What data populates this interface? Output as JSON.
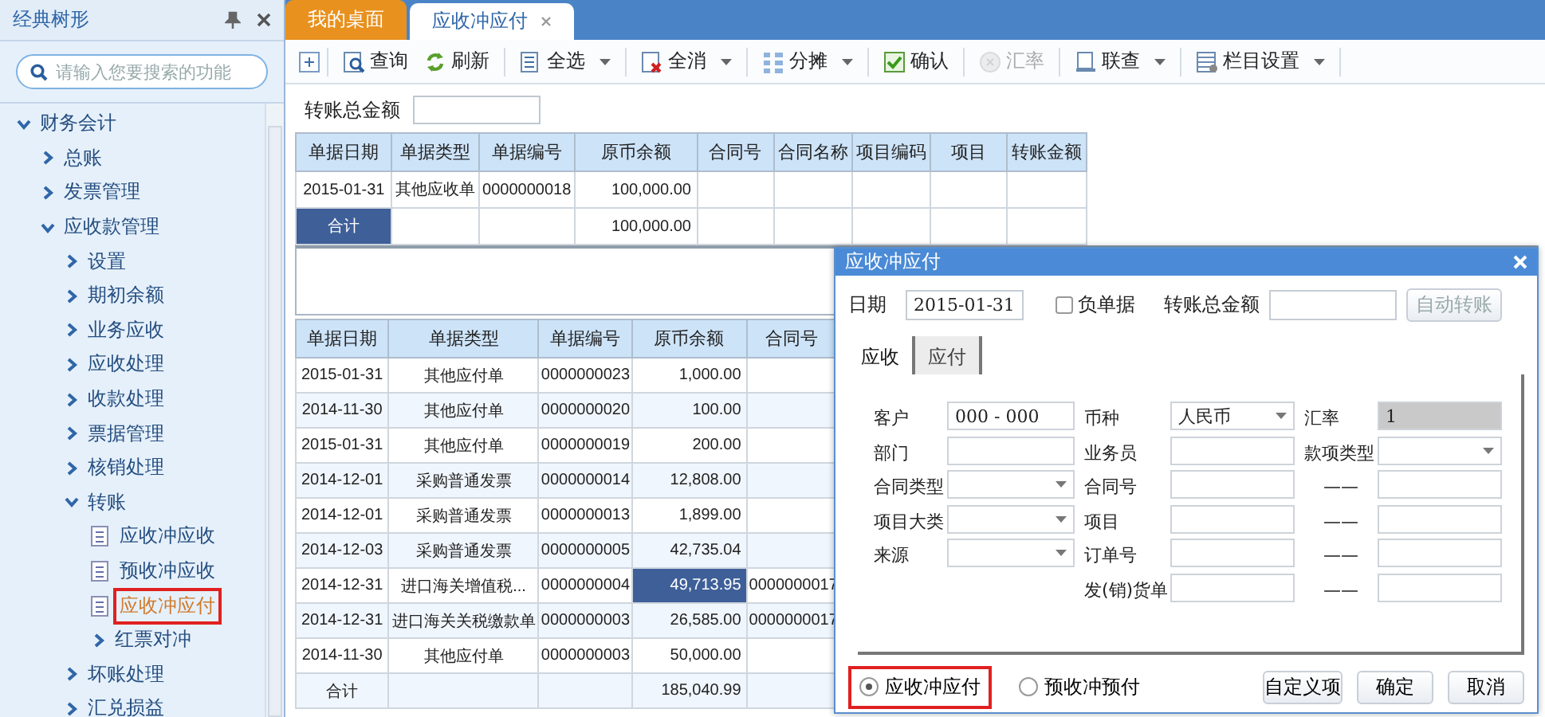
{
  "sidebar": {
    "title": "经典树形",
    "search": {
      "placeholder": "请输入您要搜索的功能"
    },
    "tree": [
      {
        "label": "财务会计",
        "kind": "folder",
        "expanded": true,
        "selected": false,
        "highlighted": false,
        "children": [
          {
            "label": "总账",
            "kind": "folder",
            "expanded": false,
            "selected": false,
            "highlighted": false
          },
          {
            "label": "发票管理",
            "kind": "folder",
            "expanded": false,
            "selected": false,
            "highlighted": false
          },
          {
            "label": "应收款管理",
            "kind": "folder",
            "expanded": true,
            "selected": false,
            "highlighted": false,
            "children": [
              {
                "label": "设置",
                "kind": "folder",
                "expanded": false,
                "selected": false,
                "highlighted": false
              },
              {
                "label": "期初余额",
                "kind": "folder",
                "expanded": false,
                "selected": false,
                "highlighted": false
              },
              {
                "label": "业务应收",
                "kind": "folder",
                "expanded": false,
                "selected": false,
                "highlighted": false
              },
              {
                "label": "应收处理",
                "kind": "folder",
                "expanded": false,
                "selected": false,
                "highlighted": false
              },
              {
                "label": "收款处理",
                "kind": "folder",
                "expanded": false,
                "selected": false,
                "highlighted": false
              },
              {
                "label": "票据管理",
                "kind": "folder",
                "expanded": false,
                "selected": false,
                "highlighted": false
              },
              {
                "label": "核销处理",
                "kind": "folder",
                "expanded": false,
                "selected": false,
                "highlighted": false
              },
              {
                "label": "转账",
                "kind": "folder",
                "expanded": true,
                "selected": false,
                "highlighted": false,
                "children": [
                  {
                    "label": "应收冲应收",
                    "kind": "page",
                    "selected": false,
                    "highlighted": false
                  },
                  {
                    "label": "预收冲应收",
                    "kind": "page",
                    "selected": false,
                    "highlighted": false
                  },
                  {
                    "label": "应收冲应付",
                    "kind": "page",
                    "selected": true,
                    "highlighted": true
                  },
                  {
                    "label": "红票对冲",
                    "kind": "folder",
                    "expanded": false,
                    "selected": false,
                    "highlighted": false
                  }
                ]
              },
              {
                "label": "坏账处理",
                "kind": "folder",
                "expanded": false,
                "selected": false,
                "highlighted": false
              },
              {
                "label": "汇兑损益",
                "kind": "folder",
                "expanded": false,
                "selected": false,
                "highlighted": false
              }
            ]
          }
        ]
      }
    ]
  },
  "tabs": [
    {
      "label": "我的桌面",
      "kind": "home",
      "selected": false,
      "closable": false
    },
    {
      "label": "应收冲应付",
      "kind": "page",
      "selected": true,
      "closable": true
    }
  ],
  "toolbar": [
    [
      {
        "kind": "add"
      }
    ],
    [
      {
        "kind": "query",
        "label": "查询",
        "dropdown": false,
        "disabled": false
      },
      {
        "kind": "refresh",
        "label": "刷新",
        "dropdown": false,
        "disabled": false
      }
    ],
    [
      {
        "kind": "select-all",
        "label": "全选",
        "dropdown": true,
        "disabled": false
      }
    ],
    [
      {
        "kind": "clear-all",
        "label": "全消",
        "dropdown": true,
        "disabled": false
      }
    ],
    [
      {
        "kind": "split",
        "label": "分摊",
        "dropdown": true,
        "disabled": false
      }
    ],
    [
      {
        "kind": "confirm",
        "label": "确认",
        "dropdown": false,
        "disabled": false
      }
    ],
    [
      {
        "kind": "rate",
        "label": "汇率",
        "dropdown": false,
        "disabled": true
      }
    ],
    [
      {
        "kind": "link",
        "label": "联查",
        "dropdown": true,
        "disabled": false
      }
    ],
    [
      {
        "kind": "columns",
        "label": "栏目设置",
        "dropdown": true,
        "disabled": false
      }
    ]
  ],
  "transfer_total": {
    "label": "转账总金额"
  },
  "receivable_grid": {
    "columns": [
      "单据日期",
      "单据类型",
      "单据编号",
      "原币余额",
      "合同号",
      "合同名称",
      "项目编码",
      "项目",
      "转账金额"
    ],
    "rows": [
      {
        "kind": "data",
        "cells": [
          {
            "text": "2015-01-31",
            "selected": false
          },
          {
            "text": "其他应收单",
            "selected": false
          },
          {
            "text": "0000000018",
            "selected": false
          },
          {
            "text": "100,000.00",
            "selected": false
          },
          {
            "selected": false
          },
          {
            "selected": false
          },
          {
            "selected": false
          },
          {
            "selected": false
          },
          {
            "selected": false
          }
        ]
      },
      {
        "kind": "total",
        "cells": [
          {
            "text": "合计",
            "selected": true
          },
          {
            "selected": false
          },
          {
            "selected": false
          },
          {
            "text": "100,000.00",
            "selected": false
          },
          {
            "selected": false
          },
          {
            "selected": false
          },
          {
            "selected": false
          },
          {
            "selected": false
          },
          {
            "selected": false
          }
        ]
      }
    ]
  },
  "payable_grid": {
    "columns": [
      "单据日期",
      "单据类型",
      "单据编号",
      "原币余额",
      "合同号"
    ],
    "rows": [
      {
        "kind": "data",
        "cells": [
          {
            "text": "2015-01-31",
            "selected": false
          },
          {
            "text": "其他应付单",
            "selected": false
          },
          {
            "text": "0000000023",
            "selected": false
          },
          {
            "text": "1,000.00",
            "selected": false
          },
          {
            "selected": false
          }
        ]
      },
      {
        "kind": "data",
        "cells": [
          {
            "text": "2014-11-30",
            "selected": false
          },
          {
            "text": "其他应付单",
            "selected": false
          },
          {
            "text": "0000000020",
            "selected": false
          },
          {
            "text": "100.00",
            "selected": false
          },
          {
            "selected": false
          }
        ]
      },
      {
        "kind": "data",
        "cells": [
          {
            "text": "2015-01-31",
            "selected": false
          },
          {
            "text": "其他应付单",
            "selected": false
          },
          {
            "text": "0000000019",
            "selected": false
          },
          {
            "text": "200.00",
            "selected": false
          },
          {
            "selected": false
          }
        ]
      },
      {
        "kind": "data",
        "cells": [
          {
            "text": "2014-12-01",
            "selected": false
          },
          {
            "text": "采购普通发票",
            "selected": false
          },
          {
            "text": "0000000014",
            "selected": false
          },
          {
            "text": "12,808.00",
            "selected": false
          },
          {
            "selected": false
          }
        ]
      },
      {
        "kind": "data",
        "cells": [
          {
            "text": "2014-12-01",
            "selected": false
          },
          {
            "text": "采购普通发票",
            "selected": false
          },
          {
            "text": "0000000013",
            "selected": false
          },
          {
            "text": "1,899.00",
            "selected": false
          },
          {
            "selected": false
          }
        ]
      },
      {
        "kind": "data",
        "cells": [
          {
            "text": "2014-12-03",
            "selected": false
          },
          {
            "text": "采购普通发票",
            "selected": false
          },
          {
            "text": "0000000005",
            "selected": false
          },
          {
            "text": "42,735.04",
            "selected": false
          },
          {
            "selected": false
          }
        ]
      },
      {
        "kind": "data",
        "cells": [
          {
            "text": "2014-12-31",
            "selected": false
          },
          {
            "text": "进口海关增值税...",
            "selected": false
          },
          {
            "text": "0000000004",
            "selected": false
          },
          {
            "text": "49,713.95",
            "selected": true
          },
          {
            "text": "0000000017",
            "selected": false
          }
        ]
      },
      {
        "kind": "data",
        "cells": [
          {
            "text": "2014-12-31",
            "selected": false
          },
          {
            "text": "进口海关关税缴款单",
            "selected": false
          },
          {
            "text": "0000000003",
            "selected": false
          },
          {
            "text": "26,585.00",
            "selected": false
          },
          {
            "text": "0000000017",
            "selected": false
          }
        ]
      },
      {
        "kind": "data",
        "cells": [
          {
            "text": "2014-11-30",
            "selected": false
          },
          {
            "text": "其他应付单",
            "selected": false
          },
          {
            "text": "0000000003",
            "selected": false
          },
          {
            "text": "50,000.00",
            "selected": false
          },
          {
            "selected": false
          }
        ]
      },
      {
        "kind": "total",
        "cells": [
          {
            "text": "合计",
            "selected": false
          },
          {
            "selected": false
          },
          {
            "selected": false
          },
          {
            "text": "185,040.99",
            "selected": false
          },
          {
            "selected": false
          }
        ]
      }
    ]
  },
  "dialog": {
    "title": "应收冲应付",
    "date": {
      "label": "日期",
      "value": "2015-01-31"
    },
    "negative": {
      "label": "负单据",
      "checked": false
    },
    "total": {
      "label": "转账总金额"
    },
    "auto_button": {
      "label": "自动转账",
      "disabled": true
    },
    "tabs": [
      {
        "label": "应收",
        "selected": true
      },
      {
        "label": "应付",
        "selected": false
      }
    ],
    "fields": [
      [
        {
          "kind": "text",
          "label": "客户",
          "value": "000 - 000"
        },
        {
          "kind": "select",
          "label": "币种",
          "value": "人民币"
        },
        {
          "kind": "readonly",
          "label": "汇率",
          "value": "1"
        }
      ],
      [
        {
          "kind": "text",
          "label": "部门"
        },
        {
          "kind": "text",
          "label": "业务员"
        },
        {
          "kind": "select",
          "label": "款项类型"
        }
      ],
      [
        {
          "kind": "select",
          "label": "合同类型"
        },
        {
          "kind": "text",
          "label": "合同号"
        },
        {
          "kind": "text",
          "label": "——"
        }
      ],
      [
        {
          "kind": "select",
          "label": "项目大类"
        },
        {
          "kind": "text",
          "label": "项目"
        },
        {
          "kind": "text",
          "label": "——"
        }
      ],
      [
        {
          "kind": "select",
          "label": "来源"
        },
        {
          "kind": "text",
          "label": "订单号"
        },
        {
          "kind": "text",
          "label": "——"
        }
      ],
      [
        {
          "kind": "blank"
        },
        {
          "kind": "text",
          "label": "发(销)货单"
        },
        {
          "kind": "text",
          "label": "——"
        }
      ]
    ],
    "modes": [
      {
        "label": "应收冲应付",
        "selected": true,
        "highlighted": true
      },
      {
        "label": "预收冲预付",
        "selected": false,
        "highlighted": false
      }
    ],
    "buttons": [
      "自定义项",
      "确定",
      "取消"
    ]
  }
}
